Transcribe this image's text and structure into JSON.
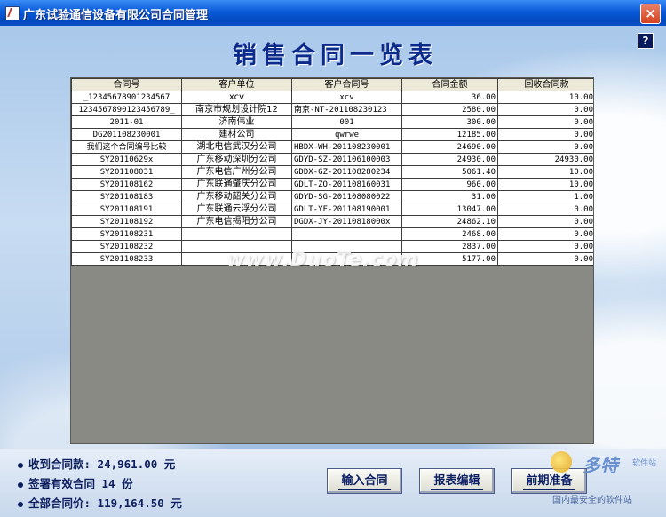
{
  "window": {
    "title": "广东试验通信设备有限公司合同管理",
    "close": "×"
  },
  "help": "?",
  "page_title": "销售合同一览表",
  "table": {
    "columns": [
      "合同号",
      "客户单位",
      "客户合同号",
      "合同金额",
      "回收合同款"
    ],
    "rows": [
      [
        "_12345678901234567",
        "xcv",
        "xcv",
        "36.00",
        "10.00"
      ],
      [
        "1234567890123456789_",
        "南京市规划设计院12",
        "南京-NT-201108230123",
        "2580.00",
        "0.00"
      ],
      [
        "2011-01",
        "济南伟业",
        "001",
        "300.00",
        "0.00"
      ],
      [
        "DG201108230001",
        "建材公司",
        "qwrwe",
        "12185.00",
        "0.00"
      ],
      [
        "我们这个合同编号比较",
        "湖北电信武汉分公司",
        "HBDX-WH-201108230001",
        "24690.00",
        "0.00"
      ],
      [
        "SY20110629x",
        "广东移动深圳分公司",
        "GDYD-SZ-201106100003",
        "24930.00",
        "24930.00"
      ],
      [
        "SY201108031",
        "广东电信广州分公司",
        "GDDX-GZ-201108280234",
        "5061.40",
        "10.00"
      ],
      [
        "SY201108162",
        "广东联通肇庆分公司",
        "GDLT-ZQ-201108160031",
        "960.00",
        "10.00"
      ],
      [
        "SY201108183",
        "广东移动韶关分公司",
        "GDYD-SG-201108080022",
        "31.00",
        "1.00"
      ],
      [
        "SY201108191",
        "广东联通云浮分公司",
        "GDLT-YF-201108190001",
        "13047.00",
        "0.00"
      ],
      [
        "SY201108192",
        "广东电信揭阳分公司",
        "DGDX-JY-20110818000x",
        "24862.10",
        "0.00"
      ],
      [
        "SY201108231",
        "",
        "",
        "2468.00",
        "0.00"
      ],
      [
        "SY201108232",
        "",
        "",
        "2837.00",
        "0.00"
      ],
      [
        "SY201108233",
        "",
        "",
        "5177.00",
        "0.00"
      ]
    ]
  },
  "watermark": "www.DuoTe.com",
  "summary": {
    "received": "收到合同款:  24,961.00 元",
    "valid": "签署有效合同 14 份",
    "total": "全部合同价:  119,164.50 元"
  },
  "buttons": {
    "input": "输入合同",
    "report": "报表编辑",
    "prepare": "前期准备"
  },
  "corner_logo": {
    "brand": "多特",
    "sub": "软件站",
    "tagline": "国内最安全的软件站"
  }
}
